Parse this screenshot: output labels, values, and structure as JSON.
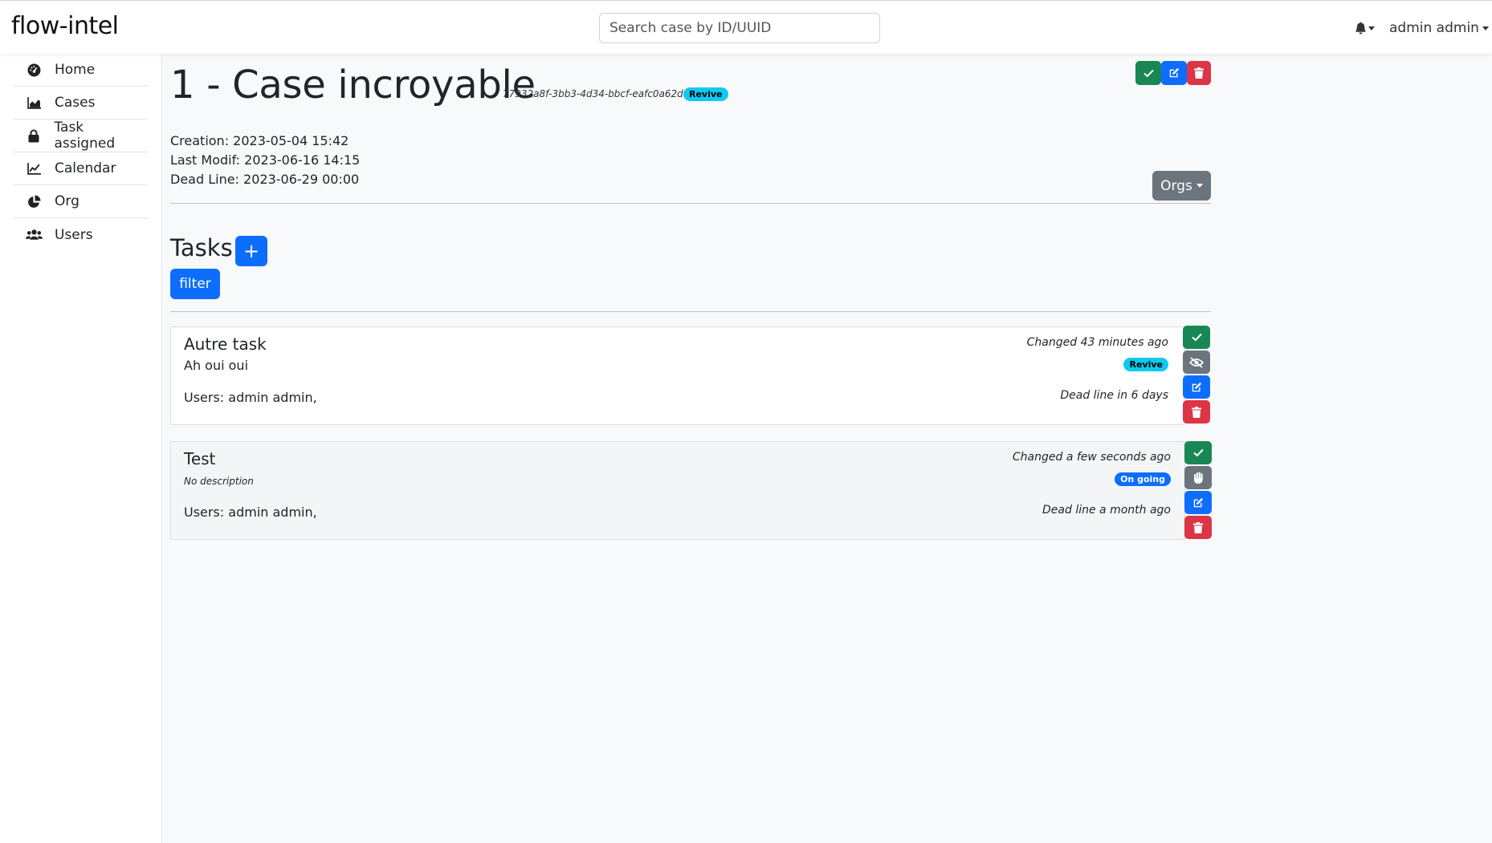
{
  "navbar": {
    "brand": "flow-intel",
    "search_placeholder": "Search case by ID/UUID",
    "user": "admin admin"
  },
  "sidebar": {
    "items": [
      {
        "label": "Home",
        "icon": "gauge-icon"
      },
      {
        "label": "Cases",
        "icon": "chart-area-icon"
      },
      {
        "label": "Task assigned",
        "icon": "lock-icon"
      },
      {
        "label": "Calendar",
        "icon": "chart-line-icon"
      },
      {
        "label": "Org",
        "icon": "chart-pie-icon"
      },
      {
        "label": "Users",
        "icon": "users-icon"
      }
    ]
  },
  "case": {
    "title": "1 - Case incroyable",
    "uuid": "77932a8f-3bb3-4d34-bbcf-eafc0a62dfae",
    "status": "Revive",
    "creation": "Creation: 2023-05-04 15:42",
    "last_modif": "Last Modif: 2023-06-16 14:15",
    "deadline": "Dead Line: 2023-06-29 00:00",
    "orgs_label": "Orgs"
  },
  "tasks_section": {
    "heading": "Tasks",
    "add_label": "+",
    "filter_label": "filter"
  },
  "tasks": [
    {
      "title": "Autre task",
      "description": "Ah oui oui",
      "users": "Users: admin admin,",
      "changed": "Changed 43 minutes ago",
      "status": "Revive",
      "deadline": "Dead line in 6 days"
    },
    {
      "title": "Test",
      "description": "No description",
      "users": "Users: admin admin,",
      "changed": "Changed a few seconds ago",
      "status": "On going",
      "deadline": "Dead line a month ago"
    }
  ],
  "colors": {
    "success": "#198754",
    "primary": "#0d6efd",
    "danger": "#dc3545",
    "secondary": "#6c757d",
    "info": "#0dcaf0"
  }
}
